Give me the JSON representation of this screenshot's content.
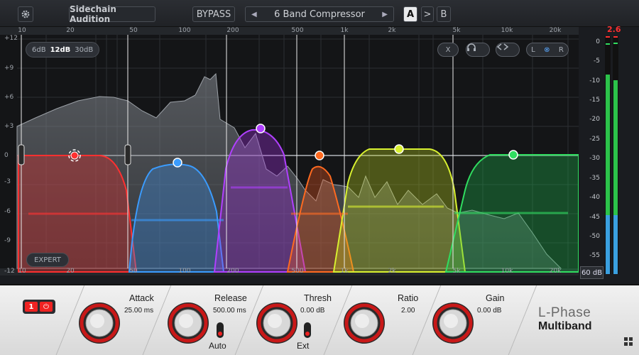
{
  "toolbar": {
    "gear": "gear-icon",
    "sidechain_label": "Sidechain Audition",
    "bypass_label": "BYPASS",
    "preset_name": "6 Band Compressor",
    "prev_arrow": "◀",
    "next_arrow": "▶",
    "a_label": "A",
    "copy_label": ">",
    "b_label": "B"
  },
  "graph": {
    "y_ticks": [
      "+12",
      "+9",
      "+6",
      "+3",
      "0",
      "-3",
      "-6",
      "-9",
      "-12"
    ],
    "x_ticks": [
      "10",
      "20",
      "50",
      "100",
      "200",
      "500",
      "1k",
      "2k",
      "5k",
      "10k",
      "20k"
    ],
    "slopes": [
      "6dB",
      "12dB",
      "30dB"
    ],
    "active_slope": "12dB",
    "expert_label": "EXPERT",
    "x_btn": "X",
    "headphones": "headphones-icon",
    "link": "link-icon",
    "l_label": "L",
    "r_label": "R",
    "band_colors": [
      "#e03030",
      "#3b8fe8",
      "#a030e0",
      "#ee5a20",
      "#c8e020",
      "#20c050"
    ]
  },
  "meter": {
    "peak": "2.6",
    "labels": [
      "0",
      "-5",
      "-10",
      "-15",
      "-20",
      "-25",
      "-30",
      "-35",
      "-40",
      "-45",
      "-50",
      "-55"
    ],
    "range": "60 dB",
    "level_left_db": -8.5,
    "level_right_db": -10
  },
  "controls": {
    "band_number": "1",
    "power": "power-icon",
    "attack": {
      "label": "Attack",
      "value": "25.00 ms"
    },
    "release": {
      "label": "Release",
      "value": "500.00 ms",
      "sub": "Auto"
    },
    "thresh": {
      "label": "Thresh",
      "value": "0.00 dB",
      "sub": "Ext"
    },
    "ratio": {
      "label": "Ratio",
      "value": "2.00"
    },
    "gain": {
      "label": "Gain",
      "value": "0.00 dB"
    }
  },
  "brand": {
    "line1": "L-Phase",
    "line2": "Multiband"
  }
}
